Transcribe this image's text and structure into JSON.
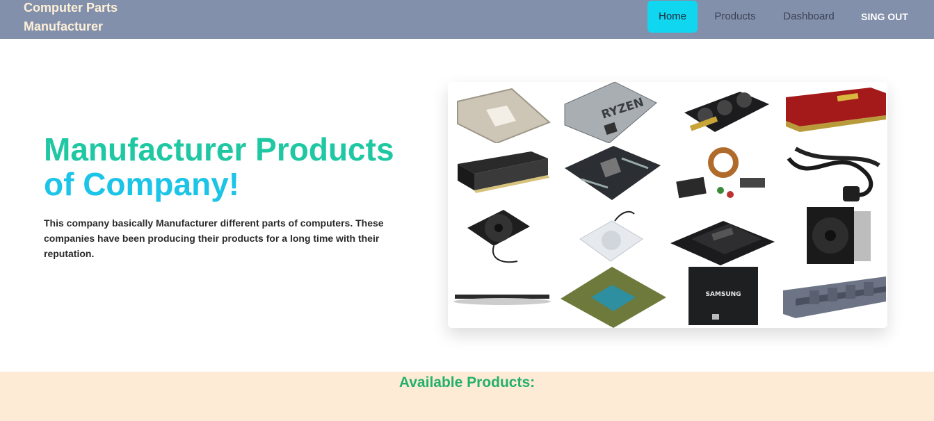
{
  "navbar": {
    "brand": "Computer Parts Manufacturer",
    "items": [
      {
        "label": "Home",
        "active": true
      },
      {
        "label": "Products"
      },
      {
        "label": "Dashboard"
      },
      {
        "label": "SING OUT"
      }
    ]
  },
  "hero": {
    "title_line1": "Manufacturer Products",
    "title_line2": "of Company!",
    "description": "This company basically Manufacturer different parts of computers. These companies have been producing their products for a long time with their reputation.",
    "image_tiles": [
      "cpu-socket",
      "ryzen-cpu",
      "graphics-card",
      "red-ram",
      "ram-stick",
      "motherboard",
      "electronic-components",
      "power-cable",
      "case-fan",
      "clear-fan",
      "ssd-open",
      "cpu-cooler",
      "ram-side",
      "cpu-chip",
      "samsung-ssd",
      "ram-pair"
    ],
    "ryzen_text": "RYZEN",
    "samsung_text": "SAMSUNG"
  },
  "products": {
    "title": "Available Products:"
  },
  "colors": {
    "navbar": "#8390ab",
    "brand": "#fdf0d8",
    "active_nav": "#11d6f0",
    "title_green": "#1fc8a3",
    "title_blue": "#1cc4e8",
    "section_bg": "#fdebd6",
    "section_title": "#23b06a"
  }
}
